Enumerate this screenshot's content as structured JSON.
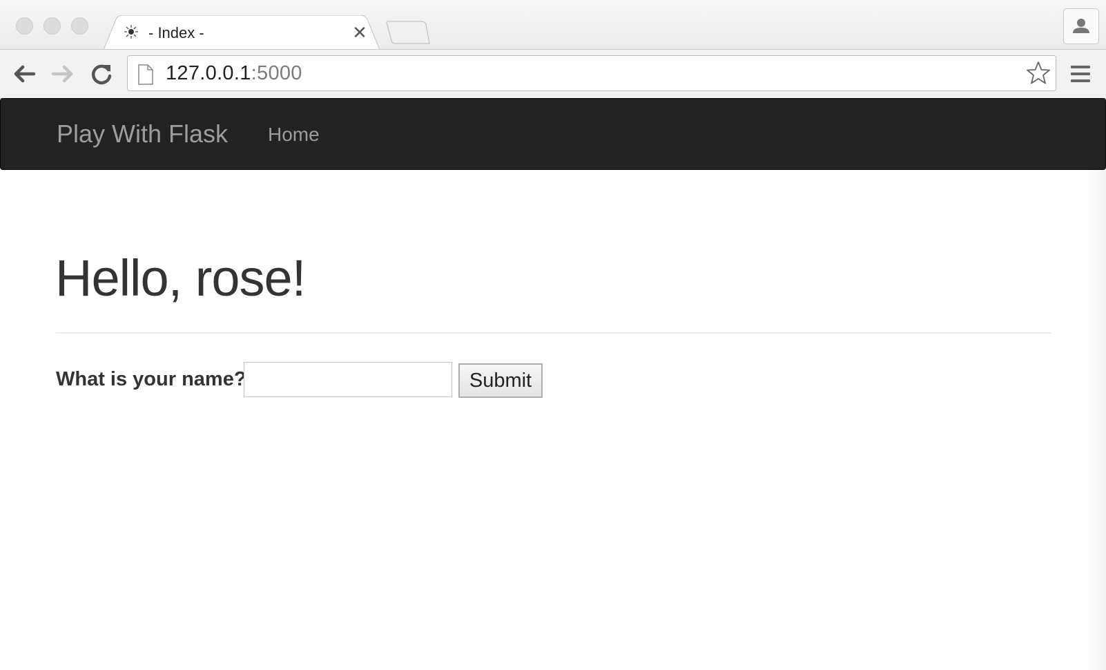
{
  "browser": {
    "tab": {
      "title": "- Index -",
      "favicon": "bug-favicon-icon"
    },
    "address_bar": {
      "host": "127.0.0.1",
      "port": ":5000"
    }
  },
  "navbar": {
    "brand": "Play With Flask",
    "links": [
      {
        "label": "Home"
      }
    ]
  },
  "main": {
    "heading": "Hello, rose!",
    "form": {
      "label": "What is your name?",
      "input_value": "",
      "submit_label": "Submit"
    }
  },
  "colors": {
    "navbar_bg": "#222222",
    "navbar_text": "#9d9d9d",
    "heading_text": "#333333"
  }
}
